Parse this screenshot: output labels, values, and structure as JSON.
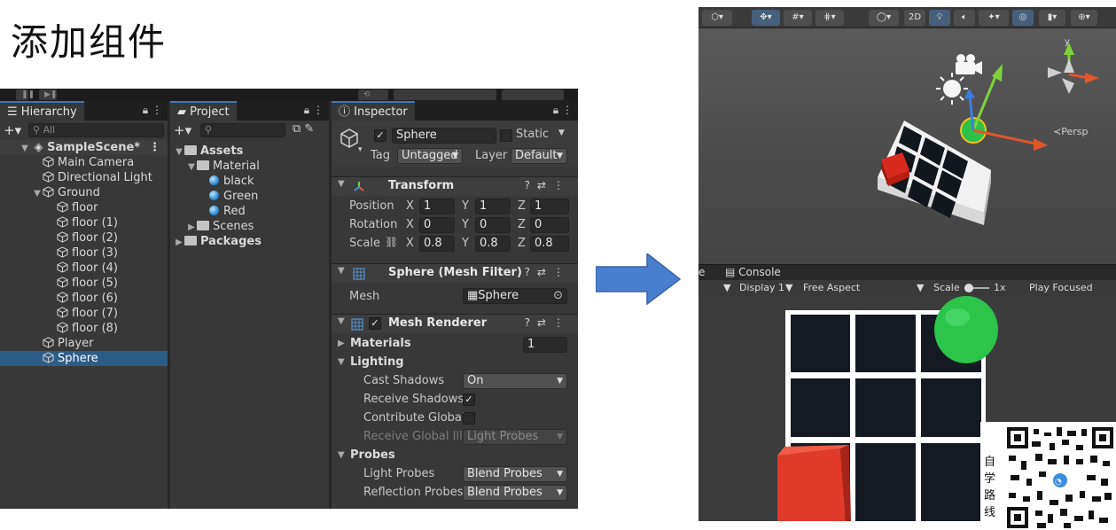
{
  "slide": {
    "title": "添加组件"
  },
  "hierarchy": {
    "tab_label": "Hierarchy",
    "search_placeholder": "All",
    "scene_name": "SampleScene*",
    "items": [
      {
        "label": "Main Camera",
        "depth": 1
      },
      {
        "label": "Directional Light",
        "depth": 1
      },
      {
        "label": "Ground",
        "depth": 1
      },
      {
        "label": "floor",
        "depth": 2
      },
      {
        "label": "floor (1)",
        "depth": 2
      },
      {
        "label": "floor (2)",
        "depth": 2
      },
      {
        "label": "floor (3)",
        "depth": 2
      },
      {
        "label": "floor (4)",
        "depth": 2
      },
      {
        "label": "floor (5)",
        "depth": 2
      },
      {
        "label": "floor (6)",
        "depth": 2
      },
      {
        "label": "floor (7)",
        "depth": 2
      },
      {
        "label": "floor (8)",
        "depth": 2
      },
      {
        "label": "Player",
        "depth": 1
      },
      {
        "label": "Sphere",
        "depth": 1,
        "selected": true
      }
    ]
  },
  "project": {
    "tab_label": "Project",
    "tree": [
      {
        "label": "Assets",
        "type": "folder-open"
      },
      {
        "label": "Material",
        "type": "folder-open"
      },
      {
        "label": "black",
        "type": "material"
      },
      {
        "label": "Green",
        "type": "material"
      },
      {
        "label": "Red",
        "type": "material"
      },
      {
        "label": "Scenes",
        "type": "folder"
      },
      {
        "label": "Packages",
        "type": "folder"
      }
    ]
  },
  "inspector": {
    "tab_label": "Inspector",
    "object_name": "Sphere",
    "static_label": "Static",
    "tag_label": "Tag",
    "tag_value": "Untagged",
    "layer_label": "Layer",
    "layer_value": "Default",
    "transform": {
      "title": "Transform",
      "position_label": "Position",
      "rotation_label": "Rotation",
      "scale_label": "Scale",
      "position": {
        "x": "1",
        "y": "1",
        "z": "1"
      },
      "rotation": {
        "x": "0",
        "y": "0",
        "z": "0"
      },
      "scale": {
        "x": "0.8",
        "y": "0.8",
        "z": "0.8"
      }
    },
    "mesh_filter": {
      "title": "Sphere (Mesh Filter)",
      "mesh_label": "Mesh",
      "mesh_value": "Sphere"
    },
    "mesh_renderer": {
      "title": "Mesh Renderer",
      "materials_label": "Materials",
      "materials_count": "1",
      "lighting_label": "Lighting",
      "cast_shadows_label": "Cast Shadows",
      "cast_shadows_value": "On",
      "receive_shadows_label": "Receive Shadows",
      "contribute_gi_label": "Contribute Global",
      "receive_gi_label": "Receive Global Illu",
      "receive_gi_value": "Light Probes",
      "probes_label": "Probes",
      "light_probes_label": "Light Probes",
      "light_probes_value": "Blend Probes",
      "reflection_probes_label": "Reflection Probes",
      "reflection_probes_value": "Blend Probes"
    }
  },
  "scene_view": {
    "toolbar_2d": "2D",
    "persp_label": "≺Persp"
  },
  "game_view": {
    "console_tab": "Console",
    "display": "Display 1",
    "aspect": "Free Aspect",
    "scale_label": "Scale",
    "scale_value": "1x",
    "play_mode": "Play Focused"
  },
  "qr": {
    "caption": "自学路线"
  },
  "colors": {
    "accent_arrow": "#4a7fd0",
    "selection": "#2c5d87",
    "red_cube": "#e03a2a",
    "green_sphere": "#2fc04a"
  }
}
